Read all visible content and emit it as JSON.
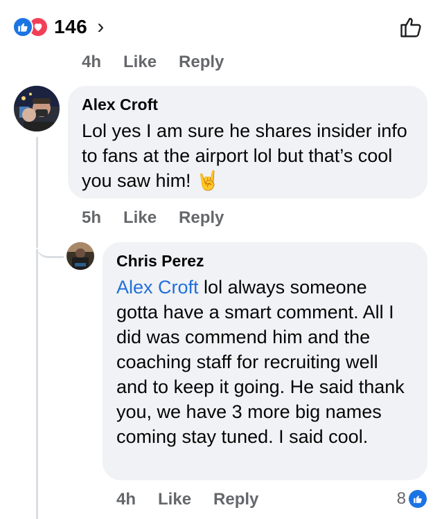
{
  "reactions": {
    "count": "146",
    "chevron": "›",
    "icons": [
      "like-icon",
      "love-icon"
    ]
  },
  "top_comment_actions": {
    "time": "4h",
    "like": "Like",
    "reply": "Reply"
  },
  "comment_alex": {
    "author": "Alex Croft",
    "text": "Lol yes I am sure he shares insider info to fans at the airport lol but that’s cool you saw him!",
    "emoji": "🤘",
    "time": "5h",
    "like": "Like",
    "reply": "Reply"
  },
  "comment_chris": {
    "author": "Chris Perez",
    "mention": "Alex Croft",
    "text": " lol always someone gotta have a smart comment. All I did was commend him and the coaching staff for recruiting well and to keep it going. He said thank you, we have 3 more big names coming stay tuned. I said cool.",
    "time": "4h",
    "like": "Like",
    "reply": "Reply",
    "like_count": "8"
  },
  "colors": {
    "accent": "#1b74e4",
    "love": "#f33e58",
    "bubble": "#f0f2f5",
    "meta": "#65676b",
    "mention": "#216fdb"
  }
}
